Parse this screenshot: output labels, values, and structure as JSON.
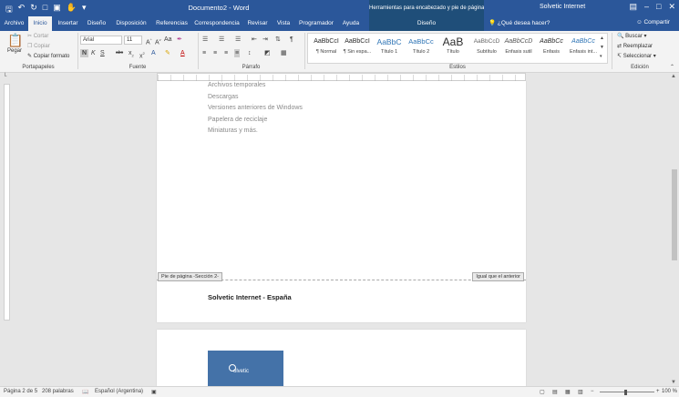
{
  "titlebar": {
    "doc_title": "Documento2 - Word",
    "context_header": "Herramientas para encabezado y pie de página",
    "user": "Solvetic Internet"
  },
  "tabs": {
    "items": [
      "Archivo",
      "Inicio",
      "Insertar",
      "Diseño",
      "Disposición",
      "Referencias",
      "Correspondencia",
      "Revisar",
      "Vista",
      "Programador",
      "Ayuda"
    ],
    "context_tab": "Diseño",
    "tell_me": "¿Qué desea hacer?",
    "share": "Compartir"
  },
  "ribbon": {
    "clipboard": {
      "paste": "Pegar",
      "cut": "Cortar",
      "copy": "Copiar",
      "format_painter": "Copiar formato",
      "label": "Portapapeles"
    },
    "font": {
      "name": "Arial",
      "size": "11",
      "label": "Fuente"
    },
    "paragraph": {
      "label": "Párrafo"
    },
    "styles": {
      "label": "Estilos",
      "items": [
        {
          "preview": "AaBbCcI",
          "name": "¶ Normal"
        },
        {
          "preview": "AaBbCcI",
          "name": "¶ Sin espa..."
        },
        {
          "preview": "AaBbC",
          "name": "Título 1"
        },
        {
          "preview": "AaBbCc",
          "name": "Título 2"
        },
        {
          "preview": "AaB",
          "name": "Título"
        },
        {
          "preview": "AaBbCcD",
          "name": "Subtítulo"
        },
        {
          "preview": "AaBbCcD",
          "name": "Énfasis sutil"
        },
        {
          "preview": "AaBbCc",
          "name": "Énfasis"
        },
        {
          "preview": "AaBbCc",
          "name": "Énfasis int..."
        }
      ]
    },
    "editing": {
      "find": "Buscar",
      "replace": "Reemplazar",
      "select": "Seleccionar",
      "label": "Edición"
    }
  },
  "document": {
    "page1_lines": [
      "Archivos temporales",
      "Descargas",
      "Versiones anteriores de Windows",
      "Papelera de reciclaje",
      "Miniaturas y más."
    ],
    "footer_tag": "Pie de página -Sección 2-",
    "same_as_previous": "Igual que el anterior",
    "footer_text": "Solvetic Internet - España",
    "logo_text": "olvetic"
  },
  "status": {
    "page": "Página 2 de 5",
    "words": "208 palabras",
    "language": "Español (Argentina)",
    "zoom": "100 %"
  },
  "colors": {
    "accent": "#2b579a",
    "context": "#1f4e79"
  }
}
